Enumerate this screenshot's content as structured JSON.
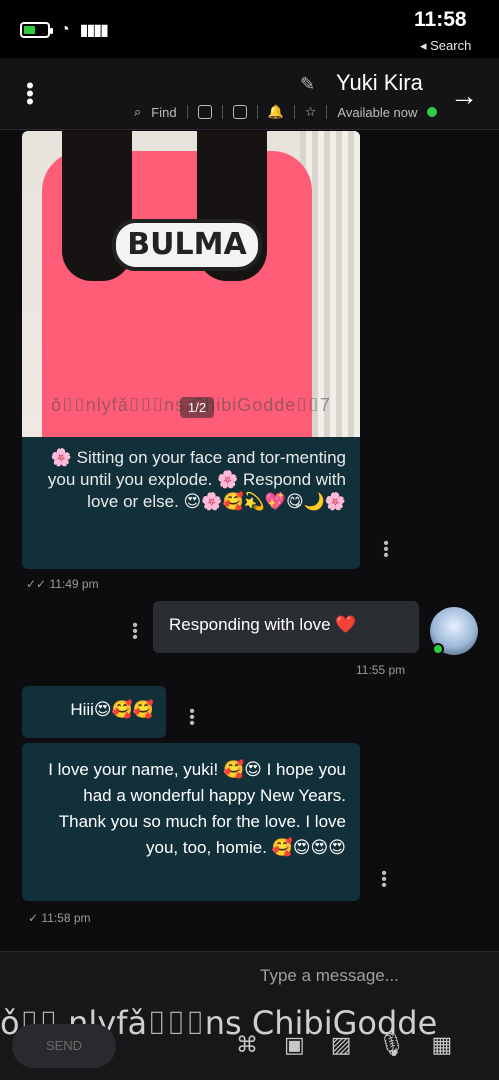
{
  "status_bar": {
    "time": "11:58",
    "back_label": "◂ Search",
    "battery_level": 0.5
  },
  "header": {
    "title": "Yuki Kira",
    "presence": "Available now",
    "find": "Find"
  },
  "messages": [
    {
      "image_watermark": "ǒ⌷⌷nlyfǎ⌷⌷⌷ns ChibiGodde⌷⌷7",
      "image_logo": "BULMA",
      "image_counter": "1/2",
      "text": "🌸 Sitting on your face and tor-menting you until you explode. 🌸 Respond with love or else. 😍🌸🥰💫💖😋🌙🌸",
      "time": "11:49 pm"
    },
    {
      "text": "Responding with love ❤️",
      "time": "11:55 pm"
    },
    {
      "text": "Hiii😍🥰🥰",
      "time": ""
    },
    {
      "text": "I love your name, yuki! 🥰😍 I hope you had a wonderful happy New Years. Thank you so much for the love. I love you, too, homie. 🥰😍😍😍",
      "time": "11:58 pm"
    }
  ],
  "composer": {
    "placeholder": "Type a message...",
    "overlay": "ǒ⌷⌷ nlyfǎ⌷⌷⌷ns ChibiGodde",
    "send": "SEND"
  },
  "colors": {
    "incoming_bubble": "#12303a",
    "outgoing_bubble": "#2a2d31",
    "online": "#2ecc40",
    "bell": "#3ab0ff"
  },
  "icons": [
    "battery-icon",
    "wifi-icon",
    "signal-icon",
    "edit-icon",
    "arrow-right-icon",
    "kebab-icon",
    "star-icon",
    "bell-icon",
    "gif-icon",
    "sticker-icon",
    "search-icon",
    "emoji-icon",
    "mic-icon",
    "image-icon",
    "camera-icon",
    "attach-icon"
  ]
}
